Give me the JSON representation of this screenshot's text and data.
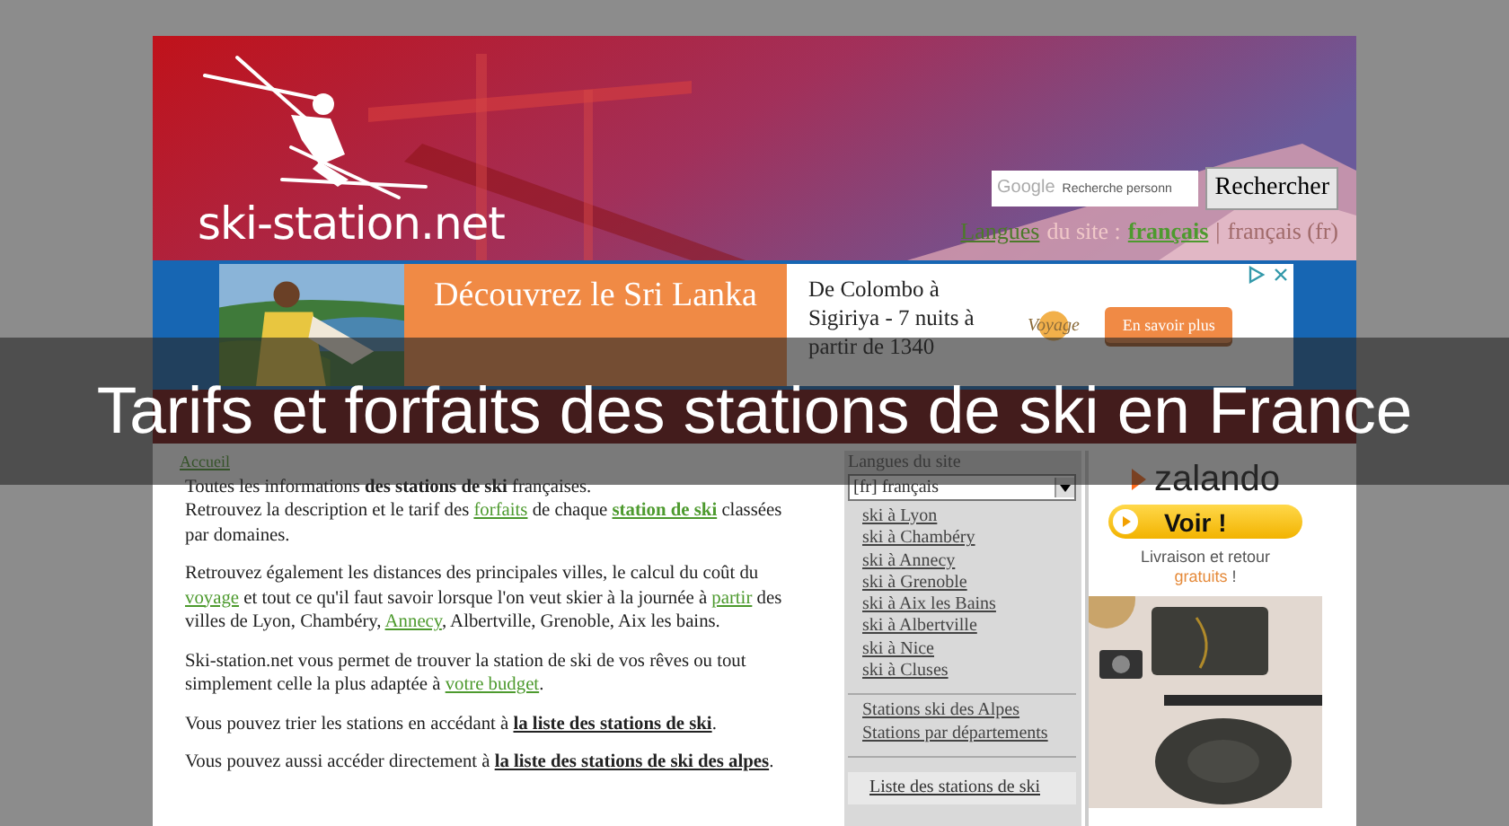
{
  "header": {
    "logo_text": "ski-station.net",
    "search": {
      "brand": "Google",
      "placeholder": "Recherche personn",
      "button": "Rechercher"
    },
    "languages": {
      "link": "Langues",
      "text": "du site :",
      "current": "français",
      "separator": "|",
      "current_full": "français (fr)"
    }
  },
  "ad_banner": {
    "headline": "Découvrez le Sri Lanka",
    "body": "De Colombo à Sigiriya - 7 nuits à partir de 1340",
    "brand": "Voyage",
    "button": "En savoir plus"
  },
  "overlay_title": "Tarifs et forfaits des stations de ski en France",
  "breadcrumb": "Accueil",
  "paragraphs": [
    [
      {
        "kind": "plain",
        "text": "Toutes les informations "
      },
      {
        "kind": "bold",
        "text": "des stations de ski"
      },
      {
        "kind": "plain",
        "text": " françaises."
      },
      {
        "kind": "break"
      },
      {
        "kind": "plain",
        "text": "Retrouvez la description et le tarif des "
      },
      {
        "kind": "link",
        "text": "forfaits"
      },
      {
        "kind": "plain",
        "text": " de chaque "
      },
      {
        "kind": "strong_link",
        "text": "station de ski"
      },
      {
        "kind": "plain",
        "text": " classées par domaines."
      }
    ],
    [
      {
        "kind": "plain",
        "text": "Retrouvez également les distances des principales villes, le calcul du coût du "
      },
      {
        "kind": "link",
        "text": "voyage"
      },
      {
        "kind": "plain",
        "text": " et tout ce qu'il faut savoir lorsque l'on veut skier à la journée à "
      },
      {
        "kind": "link",
        "text": "partir"
      },
      {
        "kind": "plain",
        "text": " des villes de Lyon, Chambéry, "
      },
      {
        "kind": "link",
        "text": "Annecy"
      },
      {
        "kind": "plain",
        "text": ", Albertville, Grenoble, Aix les bains."
      }
    ],
    [
      {
        "kind": "plain",
        "text": "Ski-station.net vous permet de trouver la station de ski de vos rêves ou tout simplement celle la plus adaptée à "
      },
      {
        "kind": "link",
        "text": "votre budget"
      },
      {
        "kind": "plain",
        "text": "."
      }
    ],
    [
      {
        "kind": "plain",
        "text": "Vous pouvez trier les stations en accédant à "
      },
      {
        "kind": "dark_link",
        "text": "la liste des stations de ski"
      },
      {
        "kind": "plain",
        "text": "."
      }
    ],
    [
      {
        "kind": "plain",
        "text": "Vous pouvez aussi accéder directement à "
      },
      {
        "kind": "dark_link",
        "text": "la liste des stations de ski des alpes"
      },
      {
        "kind": "plain",
        "text": "."
      }
    ]
  ],
  "sidebar": {
    "title": "Langues du site",
    "language_select": "[fr] français",
    "city_links": [
      "ski à Lyon",
      "ski à Chambéry",
      "ski à Annecy",
      "ski à Grenoble",
      "ski à Aix les Bains",
      "ski à Albertville",
      "ski à Nice",
      "ski à Cluses"
    ],
    "region_links": [
      "Stations ski des Alpes",
      "Stations par départements"
    ],
    "list_button": "Liste des stations de ski"
  },
  "side_ad": {
    "brand": "zalando",
    "button": "Voir !",
    "note": [
      {
        "kind": "plain",
        "text": "Livraison et retour "
      },
      {
        "kind": "highlight",
        "text": "gratuits"
      },
      {
        "kind": "plain",
        "text": " !"
      }
    ]
  }
}
